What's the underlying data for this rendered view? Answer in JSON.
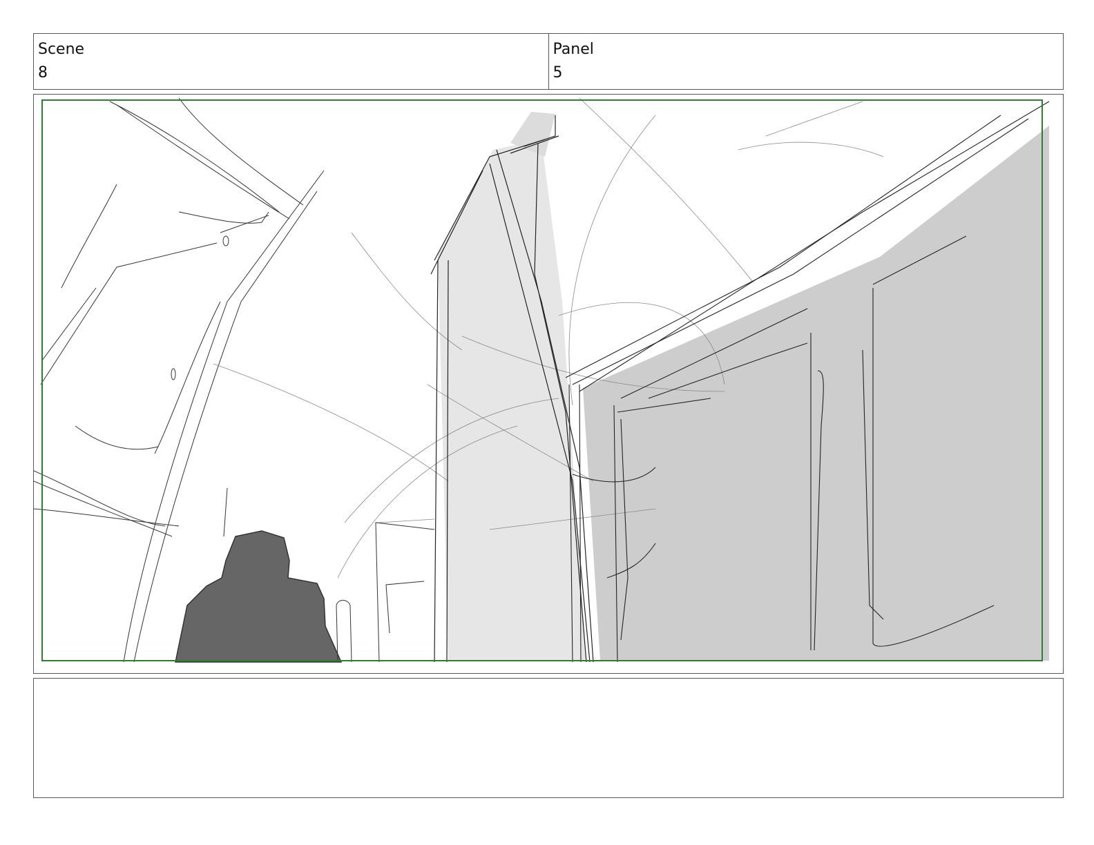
{
  "header": {
    "scene_label": "Scene",
    "scene_value": "8",
    "panel_label": "Panel",
    "panel_value": "5"
  },
  "frame": {
    "safe_area_color": "#2e7d32",
    "description_icons": [
      "figure-silhouette",
      "building-wall",
      "pillar"
    ]
  },
  "notes": {
    "text": ""
  }
}
